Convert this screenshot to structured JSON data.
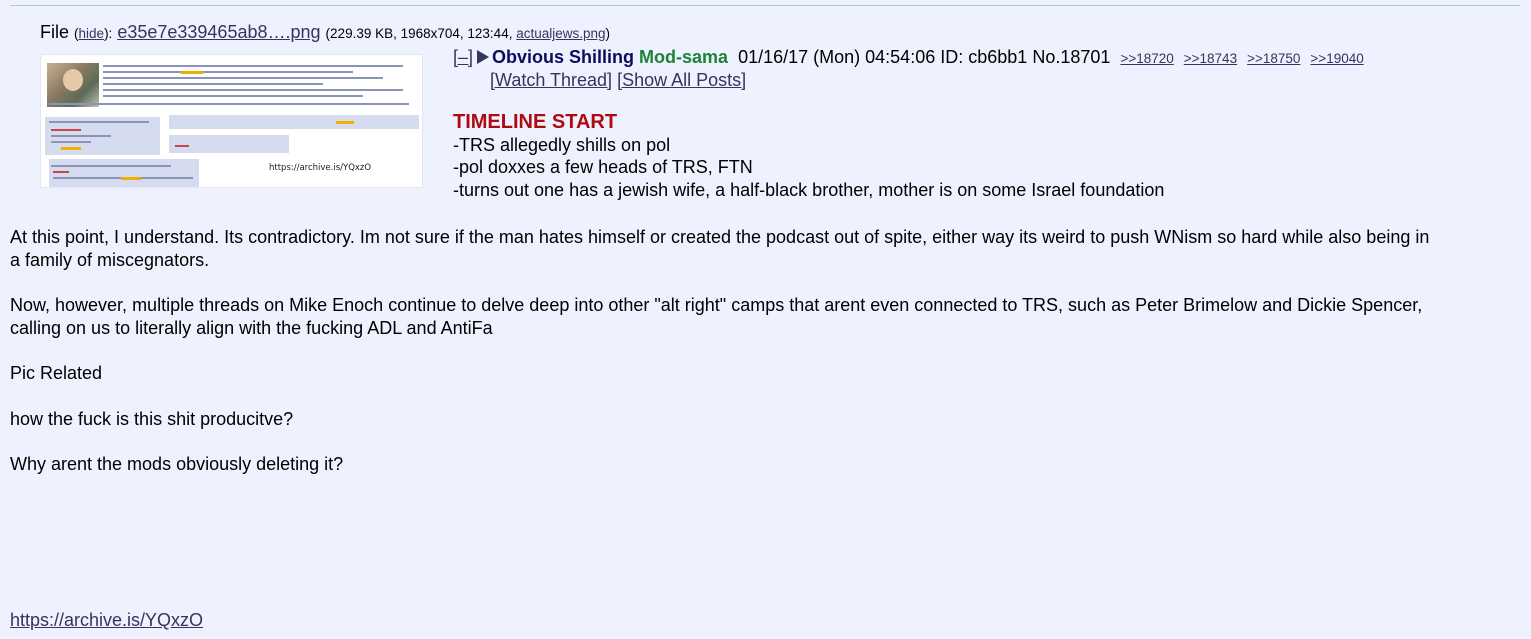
{
  "file": {
    "prefix": "File",
    "hide_label": "hide",
    "filename": "e35e7e339465ab8….png",
    "meta_prefix": "229.39 KB, 1968x704, 123:44, ",
    "original_name": "actualjews.png",
    "thumb_url_text": "https://archive.is/YQxzO"
  },
  "post": {
    "toggle_label": "[–]",
    "subject": "Obvious Shilling",
    "capcode": "Mod-sama",
    "datetime": "01/16/17 (Mon) 04:54:06",
    "id_label": "ID:",
    "id_value": "cb6bb1",
    "number": "No.18701",
    "backlinks": [
      ">>18720",
      ">>18743",
      ">>18750",
      ">>19040"
    ],
    "watch_thread": "[Watch Thread]",
    "show_all_posts": "[Show All Posts]"
  },
  "timeline": {
    "heading": "TIMELINE START",
    "lines": [
      "-TRS allegedly shills on pol",
      "-pol doxxes a few heads of TRS, FTN",
      "-turns out one has a jewish wife, a half-black brother, mother is on some Israel foundation"
    ]
  },
  "body": {
    "paragraphs": [
      "At this point, I understand. Its contradictory. Im not sure if the man hates himself or created the podcast out of spite, either way its weird to push WNism so hard while also being in a family of miscegnators.",
      "Now, however, multiple threads on Mike Enoch continue to delve deep into other \"alt right\" camps that arent even connected to TRS, such as Peter Brimelow and Dickie Spencer, calling on us to literally align with the fucking ADL and AntiFa",
      "Pic Related",
      "how the fuck is this shit producitve?",
      "Why arent the mods obviously deleting it?"
    ],
    "archive_link": "https://archive.is/YQxzO"
  },
  "colors": {
    "background": "#eef2ff",
    "subject": "#0f0c5d",
    "capcode": "#1e8237",
    "heading": "#af0a0f",
    "link": "#34345c"
  }
}
